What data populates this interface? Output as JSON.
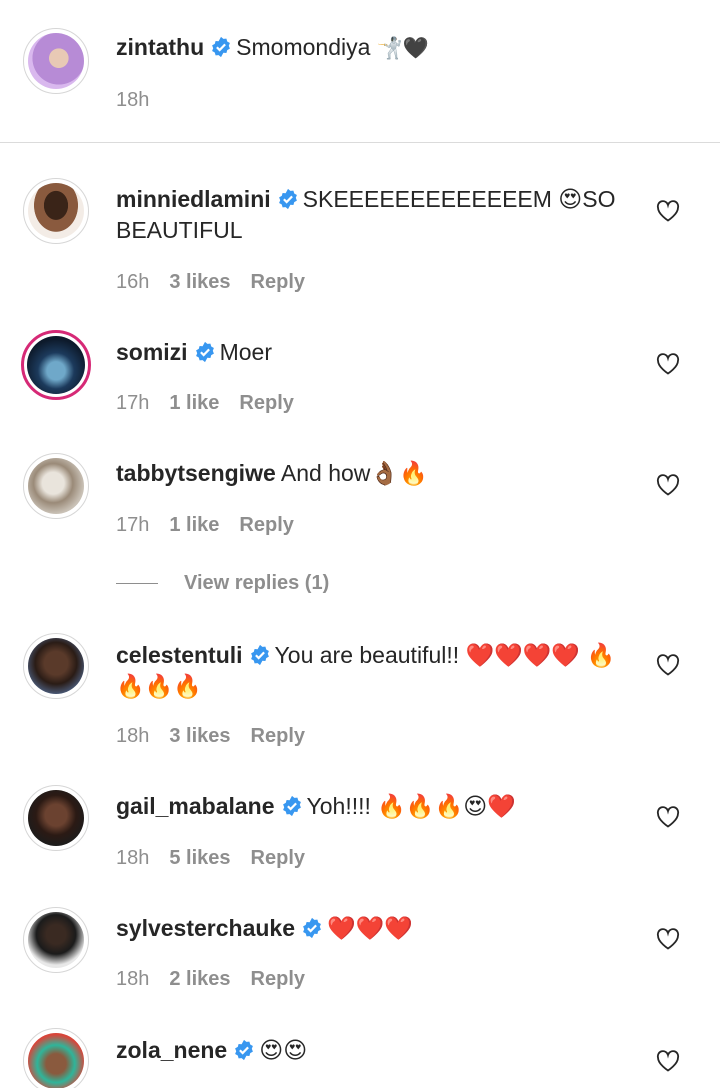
{
  "colors": {
    "text": "#262626",
    "meta": "#8e8e8e",
    "verified": "#3897f0",
    "story_ring": "#d62976"
  },
  "caption": {
    "username": "zintathu",
    "text": "Smomondiya",
    "emoji": "🤺🖤",
    "time": "18h"
  },
  "comments": [
    {
      "username": "minniedlamini",
      "text": "SKEEEEEEEEEEEEEM 😍SO BEAUTIFUL",
      "time": "16h",
      "likes": "3 likes",
      "reply": "Reply"
    },
    {
      "username": "somizi",
      "text": "Moer",
      "time": "17h",
      "likes": "1 like",
      "reply": "Reply"
    },
    {
      "username": "tabbytsengiwe",
      "text": "And how👌🏾🔥",
      "time": "17h",
      "likes": "1 like",
      "reply": "Reply",
      "view_replies": "View replies (1)"
    },
    {
      "username": "celestentuli",
      "text": "You are beautiful!! ❤️❤️❤️❤️ 🔥🔥🔥🔥",
      "time": "18h",
      "likes": "3 likes",
      "reply": "Reply"
    },
    {
      "username": "gail_mabalane",
      "text": "Yoh!!!! 🔥🔥🔥😍❤️",
      "time": "18h",
      "likes": "5 likes",
      "reply": "Reply"
    },
    {
      "username": "sylvesterchauke",
      "text": "❤️❤️❤️",
      "time": "18h",
      "likes": "2 likes",
      "reply": "Reply"
    },
    {
      "username": "zola_nene",
      "text": "😍😍",
      "time": "",
      "likes": "",
      "reply": ""
    }
  ]
}
